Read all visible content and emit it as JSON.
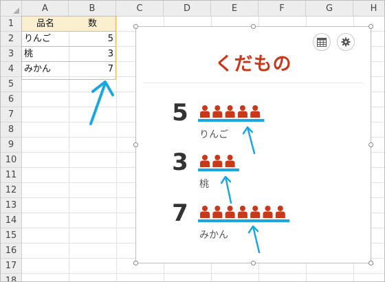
{
  "columns": [
    "A",
    "B",
    "C",
    "D",
    "E",
    "F",
    "G",
    "H"
  ],
  "rows": [
    "1",
    "2",
    "3",
    "4",
    "5",
    "6",
    "7",
    "8",
    "9",
    "10",
    "11",
    "12",
    "13",
    "14",
    "15",
    "16",
    "17",
    "18"
  ],
  "table": {
    "headers": [
      "品名",
      "数"
    ],
    "rows": [
      {
        "name": "りんご",
        "qty": "5"
      },
      {
        "name": "桃",
        "qty": "3"
      },
      {
        "name": "みかん",
        "qty": "7"
      }
    ]
  },
  "chart": {
    "title": "くだもの",
    "accent_color": "#c8381b",
    "bar_color": "#1aa7e0",
    "icons": {
      "table_button": "table-icon",
      "settings_button": "gear-icon",
      "unit": "person-icon"
    },
    "items": [
      {
        "label": "りんご",
        "value": 5
      },
      {
        "label": "桃",
        "value": 3
      },
      {
        "label": "みかん",
        "value": 7
      }
    ]
  }
}
